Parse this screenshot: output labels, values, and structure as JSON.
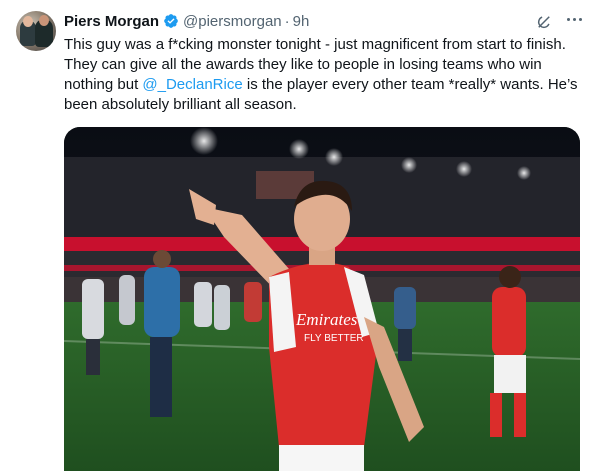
{
  "author": {
    "name": "Piers Morgan",
    "handle": "@piersmorgan",
    "separator": "·",
    "time": "9h"
  },
  "tweet": {
    "text_before": "This guy was a f*cking monster tonight - just magnificent from start to finish. They can give all the awards they like to people in losing teams who win nothing but ",
    "mention": "@_DeclanRice",
    "text_after": " is the player every other team *really* wants. He’s been absolutely brilliant all season."
  },
  "media": {
    "shirt_text_1": "Emirates",
    "shirt_text_2": "FLY BETTER"
  },
  "icons": {
    "verified": "verified-badge-icon",
    "grok": "grok-icon",
    "more": "more-options-icon"
  },
  "colors": {
    "accent": "#1d9bf0",
    "secondary_text": "#536471",
    "arsenal_red": "#db2d2b"
  }
}
